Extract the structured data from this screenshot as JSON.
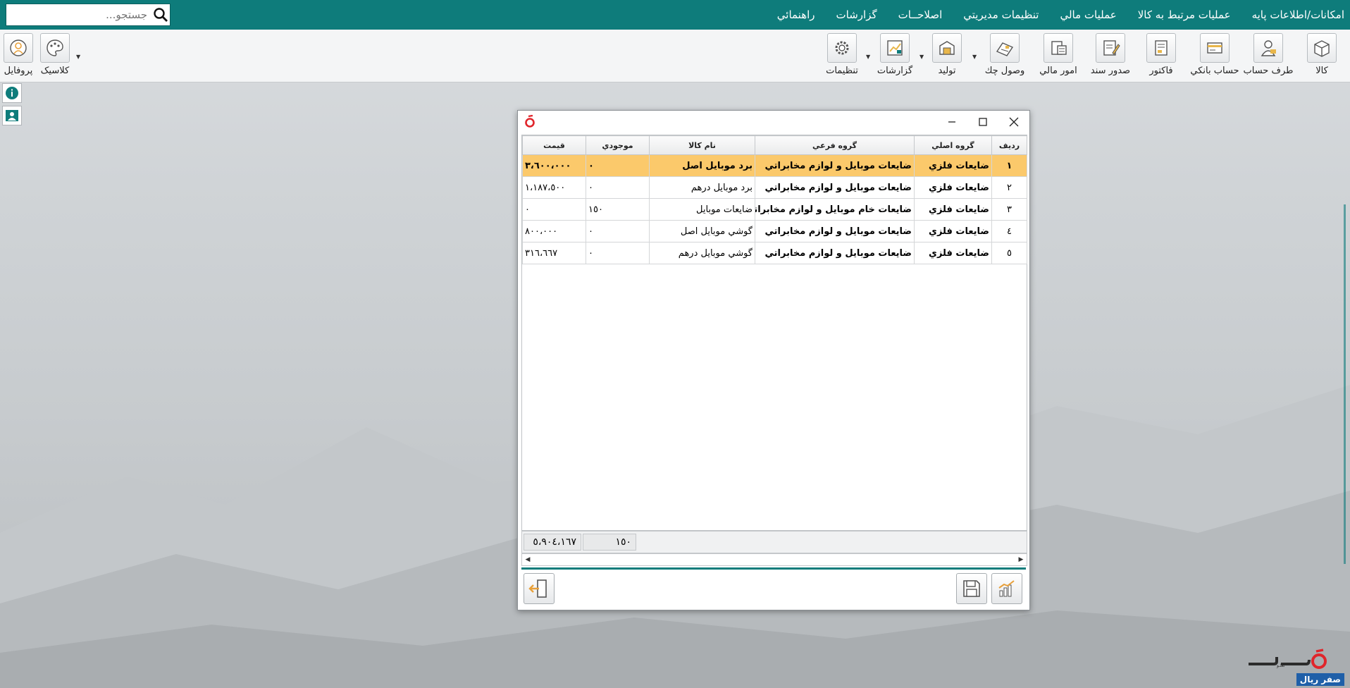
{
  "menu": {
    "items": [
      "امکانات/اطلاعات پايه",
      "عمليات مرتبط به کالا",
      "عمليات مالي",
      "تنظيمات مديريتي",
      "اصلاحــات",
      "گزارشات",
      "راهنمائي"
    ],
    "search_placeholder": "جستجو..."
  },
  "toolbar": {
    "tools": [
      {
        "label": "کالا",
        "icon": "box-icon"
      },
      {
        "label": "طرف حساب",
        "icon": "person-icon"
      },
      {
        "label": "حساب بانکي",
        "icon": "bank-card-icon"
      },
      {
        "label": "فاکتور",
        "icon": "invoice-icon"
      },
      {
        "label": "صدور سند",
        "icon": "document-pen-icon"
      },
      {
        "label": "امور مالي",
        "icon": "finance-icon"
      },
      {
        "label": "وصول چك",
        "icon": "check-icon"
      },
      {
        "label": "توليد",
        "icon": "production-icon"
      },
      {
        "label": "گزارشات",
        "icon": "report-chart-icon"
      },
      {
        "label": "تنظيمات",
        "icon": "gear-icon"
      }
    ],
    "theme_label": "کلاسيک",
    "profile_label": "پروفايل"
  },
  "grid": {
    "columns": [
      "رديف",
      "گروه اصلي",
      "گروه فرعي",
      "نام کالا",
      "موجودي",
      "قيمت"
    ],
    "rows": [
      {
        "row": "١",
        "main": "ضايعات فلزي",
        "sub": "ضايعات موبايل و لوازم مخابراتي",
        "name": "برد موبايل اصل",
        "qty": "٠",
        "price": "٣،٦٠٠،٠٠٠"
      },
      {
        "row": "٢",
        "main": "ضايعات فلزي",
        "sub": "ضايعات موبايل و لوازم مخابراتي",
        "name": "برد موبايل درهم",
        "qty": "٠",
        "price": "١،١٨٧،٥٠٠"
      },
      {
        "row": "٣",
        "main": "ضايعات فلزي",
        "sub": "ضايعات خام موبايل و لوازم مخابراتي",
        "name": "ضايعات موبايل",
        "qty": "١٥٠",
        "price": "٠"
      },
      {
        "row": "٤",
        "main": "ضايعات فلزي",
        "sub": "ضايعات موبايل و لوازم مخابراتي",
        "name": "گوشي موبايل اصل",
        "qty": "٠",
        "price": "٨٠٠،٠٠٠"
      },
      {
        "row": "٥",
        "main": "ضايعات فلزي",
        "sub": "ضايعات موبايل و لوازم مخابراتي",
        "name": "گوشي موبايل درهم",
        "qty": "٠",
        "price": "٣١٦،٦٦٧"
      }
    ],
    "selected_row": 0,
    "total_qty": "١٥٠",
    "total_price": "٥،٩٠٤،١٦٧"
  },
  "brand": {
    "name": "نعلـو",
    "badge": "صفر ريال"
  },
  "colors": {
    "accent": "#0e7c7b",
    "selection": "#fbc96b",
    "brand_red": "#e0252b"
  }
}
